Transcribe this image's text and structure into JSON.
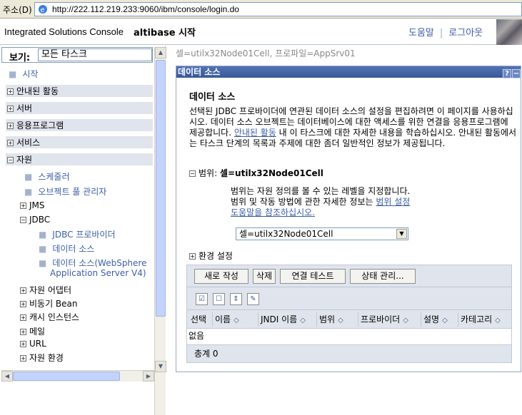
{
  "browser": {
    "address_label": "주소(D)",
    "url": "http://222.112.219.233:9060/ibm/console/login.do"
  },
  "header": {
    "brand": "Integrated Solutions Console",
    "app_name": "altibase 시작",
    "help_link": "도움말",
    "separator": "|",
    "logout_link": "로그아웃"
  },
  "nav": {
    "view_label": "보기:",
    "view_value": "모든 타스크",
    "start": "시작",
    "categories": [
      "안내된 활동",
      "서버",
      "응용프로그램",
      "서비스",
      "자원"
    ],
    "resource_children": [
      "스케줄러",
      "오브젝트 풀 관리자"
    ],
    "jms": "JMS",
    "jdbc": "JDBC",
    "jdbc_children": [
      "JDBC 프로바이더",
      "데이터 소스",
      "데이터 소스(WebSphere",
      "Application Server V4)"
    ],
    "more": [
      "자원 어댑터",
      "비동기 Bean",
      "캐시 인스턴스",
      "메일",
      "URL",
      "자원 환경"
    ]
  },
  "main": {
    "cell_path": "셀=utilx32Node01Cell, 프로파일=AppSrv01",
    "portlet_title": "데이터 소스",
    "heading": "데이터 소스",
    "desc_part1": "선택된 JDBC 프로바이더에 연관된 데이터 소스의 설정을 편집하려면 이 페이지를 사용하십시오. 데이터 소스 오브젝트는 데이터베이스에 대한 액세스를 위한 연결을 응용프로그램에 제공합니다. ",
    "desc_link": "안내된 활동",
    "desc_part2": " 내 이 타스크에 대한 자세한 내용을 학습하십시오. 안내된 활동에서는 타스크 단계의 목록과 주제에 대한 좀더 일반적인 정보가 제공됩니다.",
    "scope_label": "범위:",
    "scope_value": "셀=utilx32Node01Cell",
    "scope_text1": "범위는 자원 정의를 볼 수 있는 레벨을 지정합니다.",
    "scope_text2": "범위 및 작동 방법에 관한 자세한 정보는 ",
    "scope_link1": "범위 설정",
    "scope_link2": "도움말을 참조하십시오.",
    "scope_select": "셀=utilx32Node01Cell",
    "env_label": "환경 설정",
    "buttons": [
      "새로 작성",
      "삭제",
      "연결 테스트",
      "상태 관리..."
    ],
    "columns": [
      "선택",
      "이름",
      "JNDI 이름",
      "범위",
      "프로바이더",
      "설명",
      "카테고리"
    ],
    "empty_text": "없음",
    "total_text": "총계 0"
  }
}
